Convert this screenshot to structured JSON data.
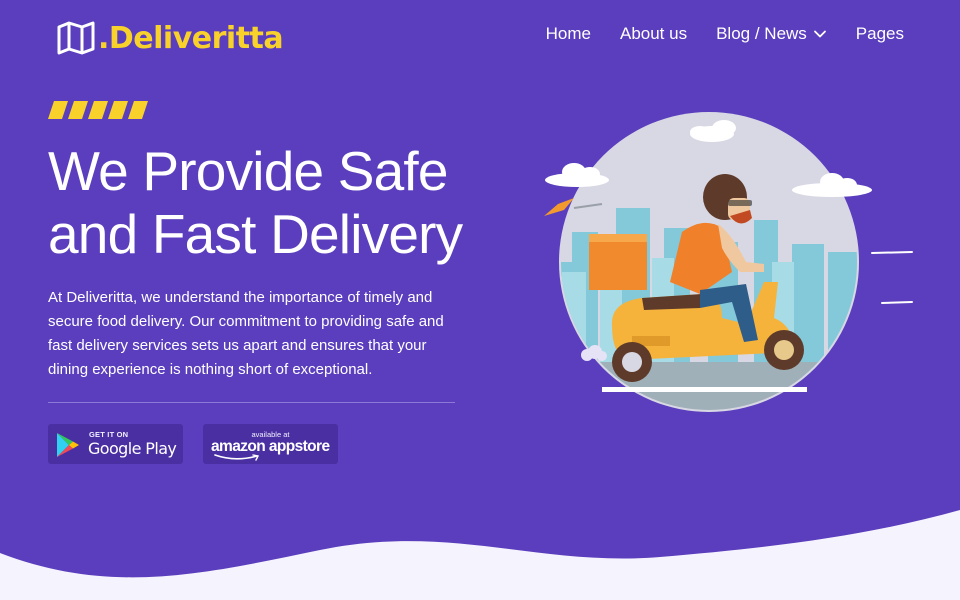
{
  "brand": {
    "name": ".Deliveritta",
    "logo_icon": "map-icon",
    "logo_color": "#f8d22b"
  },
  "nav": {
    "items": [
      {
        "label": "Home"
      },
      {
        "label": "About us"
      },
      {
        "label": "Blog / News",
        "icon": "chevron-down-icon"
      },
      {
        "label": "Pages"
      }
    ]
  },
  "hero": {
    "title_line1": "We Provide Safe",
    "title_line2": "and Fast Delivery",
    "description": "At Deliveritta, we understand the importance of timely and secure food delivery. Our commitment to providing safe and fast delivery services sets us apart and ensures that your dining experience is nothing short of exceptional.",
    "illustration": "delivery-scooter-rider"
  },
  "stores": {
    "google_play": {
      "small": "GET IT ON",
      "big": "Google Play",
      "icon": "google-play-icon"
    },
    "amazon": {
      "small": "available at",
      "big": "amazon appstore"
    }
  },
  "colors": {
    "background": "#5b3ebd",
    "accent": "#f8d22b",
    "button_bg": "#4a2fa3",
    "wave": "#f5f3fd"
  }
}
